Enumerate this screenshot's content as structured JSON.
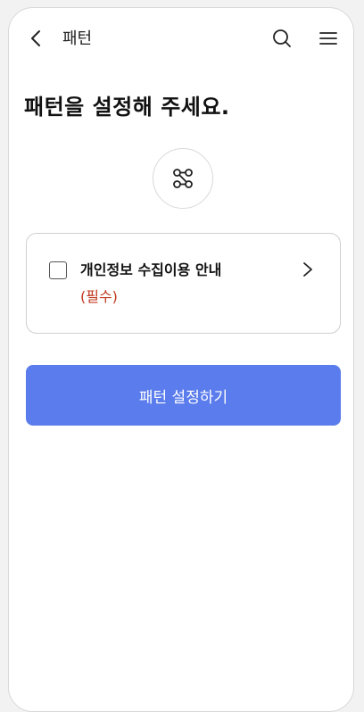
{
  "header": {
    "back_icon": "chevron-left-icon",
    "title": "패턴",
    "search_icon": "search-icon",
    "menu_icon": "hamburger-menu-icon"
  },
  "main": {
    "title": "패턴을 설정해 주세요.",
    "pattern_icon": "pattern-lock-icon",
    "consent": {
      "label": "개인정보 수집이용 안내",
      "required": "(필수)",
      "checked": false,
      "chevron_icon": "chevron-right-icon"
    },
    "submit_label": "패턴 설정하기"
  },
  "colors": {
    "accent": "#5b7cec",
    "required": "#c0391f",
    "text": "#111111",
    "border": "#cfcfcf"
  }
}
